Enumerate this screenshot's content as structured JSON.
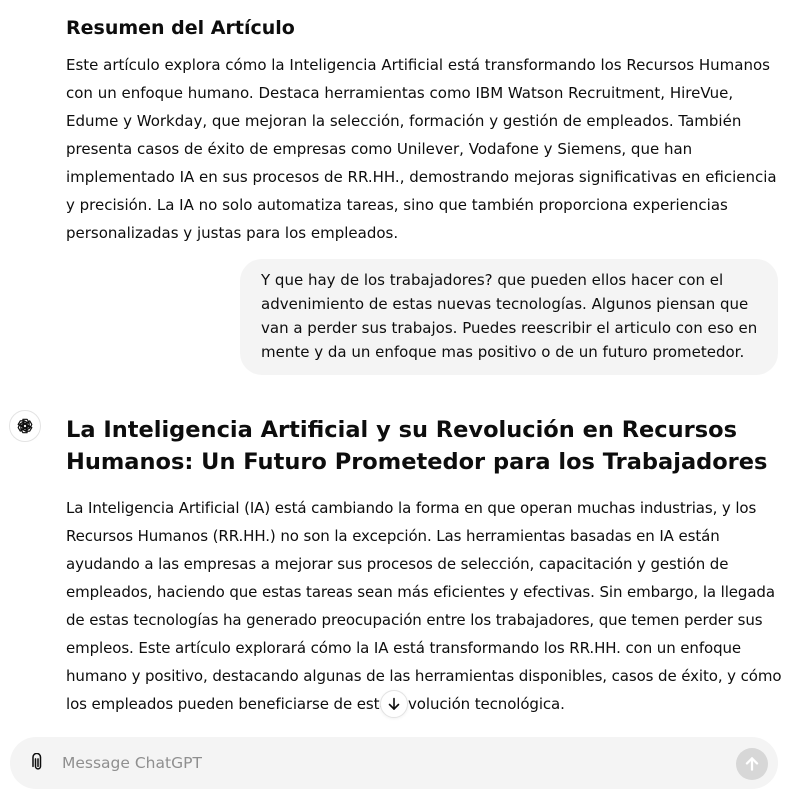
{
  "conversation": {
    "previous_reply": {
      "heading": "Resumen del Artículo",
      "text": "Este artículo explora cómo la Inteligencia Artificial está transformando los Recursos Humanos con un enfoque humano. Destaca herramientas como IBM Watson Recruitment, HireVue, Edume y Workday, que mejoran la selección, formación y gestión de empleados. También presenta casos de éxito de empresas como Unilever, Vodafone y Siemens, que han implementado IA en sus procesos de RR.HH., demostrando mejoras significativas en eficiencia y precisión. La IA no solo automatiza tareas, sino que también proporciona experiencias personalizadas y justas para los empleados."
    },
    "user_message": {
      "text": "Y que hay de los trabajadores? que pueden ellos hacer con el advenimiento de estas nuevas tecnologías. Algunos piensan que van a perder sus trabajos. Puedes reescribir el articulo con eso en mente y da un enfoque mas positivo o de un futuro prometedor."
    },
    "assistant_reply": {
      "avatar_icon": "openai-logo-icon",
      "title": "La Inteligencia Artificial y su Revolución en Recursos Humanos: Un Futuro Prometedor para los Trabajadores",
      "paragraph": "La Inteligencia Artificial (IA) está cambiando la forma en que operan muchas industrias, y los Recursos Humanos (RR.HH.) no son la excepción. Las herramientas basadas en IA están ayudando a las empresas a mejorar sus procesos de selección, capacitación y gestión de empleados, haciendo que estas tareas sean más eficientes y efectivas. Sin embargo, la llegada de estas tecnologías ha generado preocupación entre los trabajadores, que temen perder sus empleos. Este artículo explorará cómo la IA está transformando los RR.HH. con un enfoque humano y positivo, destacando algunas de las herramientas disponibles, casos de éxito, y cómo los empleados pueden beneficiarse de esta revolución tecnológica."
    }
  },
  "scroll_button": {
    "icon": "arrow-down-icon"
  },
  "composer": {
    "placeholder": "Message ChatGPT",
    "value": "",
    "attach_icon": "paperclip-icon",
    "send_icon": "arrow-up-icon"
  }
}
